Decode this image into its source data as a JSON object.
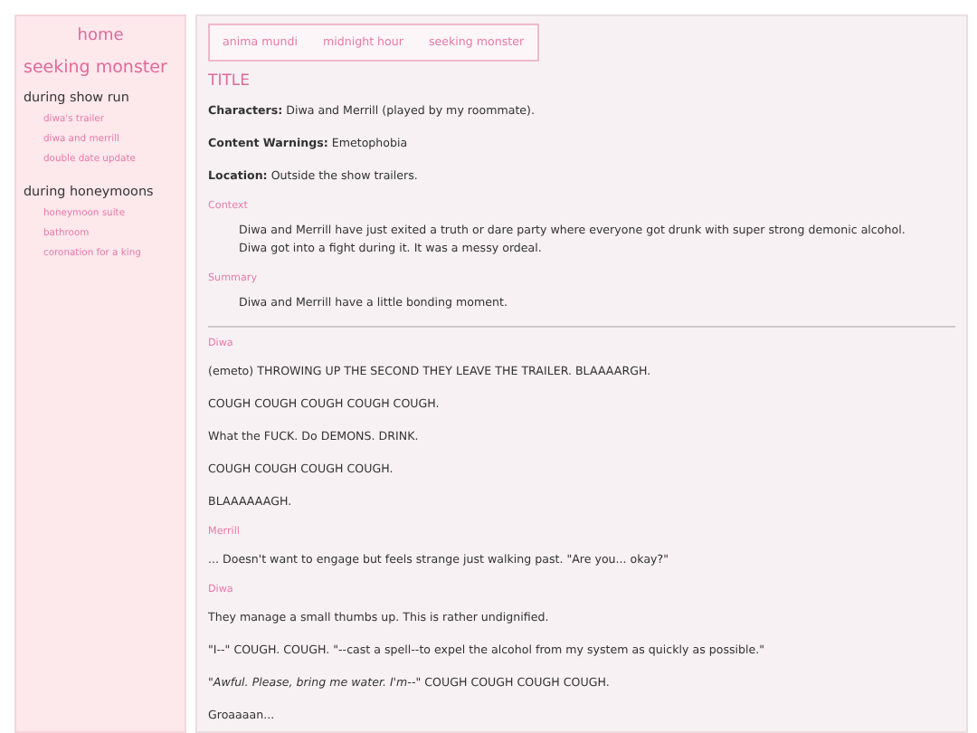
{
  "sidebar": {
    "home": "home",
    "title": "seeking monster",
    "sections": [
      {
        "heading": "during show run",
        "items": [
          "diwa's trailer",
          "diwa and merrill",
          "double date update"
        ]
      },
      {
        "heading": "during honeymoons",
        "items": [
          "honeymoon suite",
          "bathroom",
          "coronation for a king"
        ]
      }
    ]
  },
  "nav": [
    "anima mundi",
    "midnight hour",
    "seeking monster"
  ],
  "post": {
    "title": "TITLE",
    "fields": [
      {
        "label": "Characters:",
        "value": "Diwa and Merrill (played by my roommate)."
      },
      {
        "label": "Content Warnings:",
        "value": "Emetophobia"
      },
      {
        "label": "Location:",
        "value": "Outside the show trailers."
      }
    ],
    "sections": [
      {
        "heading": "Context",
        "lines": [
          "Diwa and Merrill have just exited a truth or dare party where everyone got drunk with super strong demonic alcohol.",
          "Diwa got into a fight during it. It was a messy ordeal."
        ]
      },
      {
        "heading": "Summary",
        "lines": [
          "Diwa and Merrill have a little bonding moment."
        ]
      }
    ],
    "log": [
      {
        "kind": "speaker",
        "text": "Diwa"
      },
      {
        "kind": "line",
        "text": "(emeto) THROWING UP THE SECOND THEY LEAVE THE TRAILER. BLAAAARGH."
      },
      {
        "kind": "line",
        "text": "COUGH COUGH COUGH COUGH COUGH."
      },
      {
        "kind": "line",
        "text": "What the FUCK. Do DEMONS. DRINK."
      },
      {
        "kind": "line",
        "text": "COUGH COUGH COUGH COUGH."
      },
      {
        "kind": "line",
        "text": "BLAAAAAAGH."
      },
      {
        "kind": "speaker",
        "text": "Merrill"
      },
      {
        "kind": "line",
        "text": "... Doesn't want to engage but feels strange just walking past. \"Are you... okay?\""
      },
      {
        "kind": "speaker",
        "text": "Diwa"
      },
      {
        "kind": "line",
        "text": "They manage a small thumbs up. This is rather undignified."
      },
      {
        "kind": "line",
        "text": "\"I--\" COUGH. COUGH. \"--cast a spell--to expel the alcohol from my system as quickly as possible.\""
      },
      {
        "kind": "line",
        "text": "*\"Awful. Please, bring me water. I'm--\"* COUGH COUGH COUGH COUGH."
      },
      {
        "kind": "line",
        "text": "Groaaaan..."
      }
    ]
  }
}
